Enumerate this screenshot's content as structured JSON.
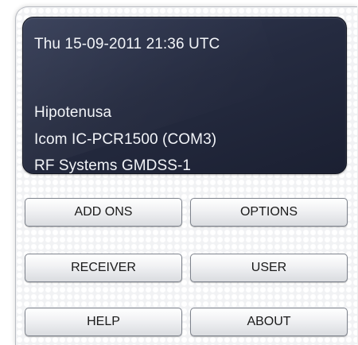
{
  "display": {
    "datetime": "Thu 15-09-2011 21:36 UTC",
    "station": "Hipotenusa",
    "receiver_info": "Icom IC-PCR1500 (COM3)",
    "antenna_info": "RF Systems GMDSS-1"
  },
  "buttons": {
    "add_ons": "ADD ONS",
    "options": "OPTIONS",
    "receiver": "RECEIVER",
    "user": "USER",
    "help": "HELP",
    "about": "ABOUT"
  }
}
